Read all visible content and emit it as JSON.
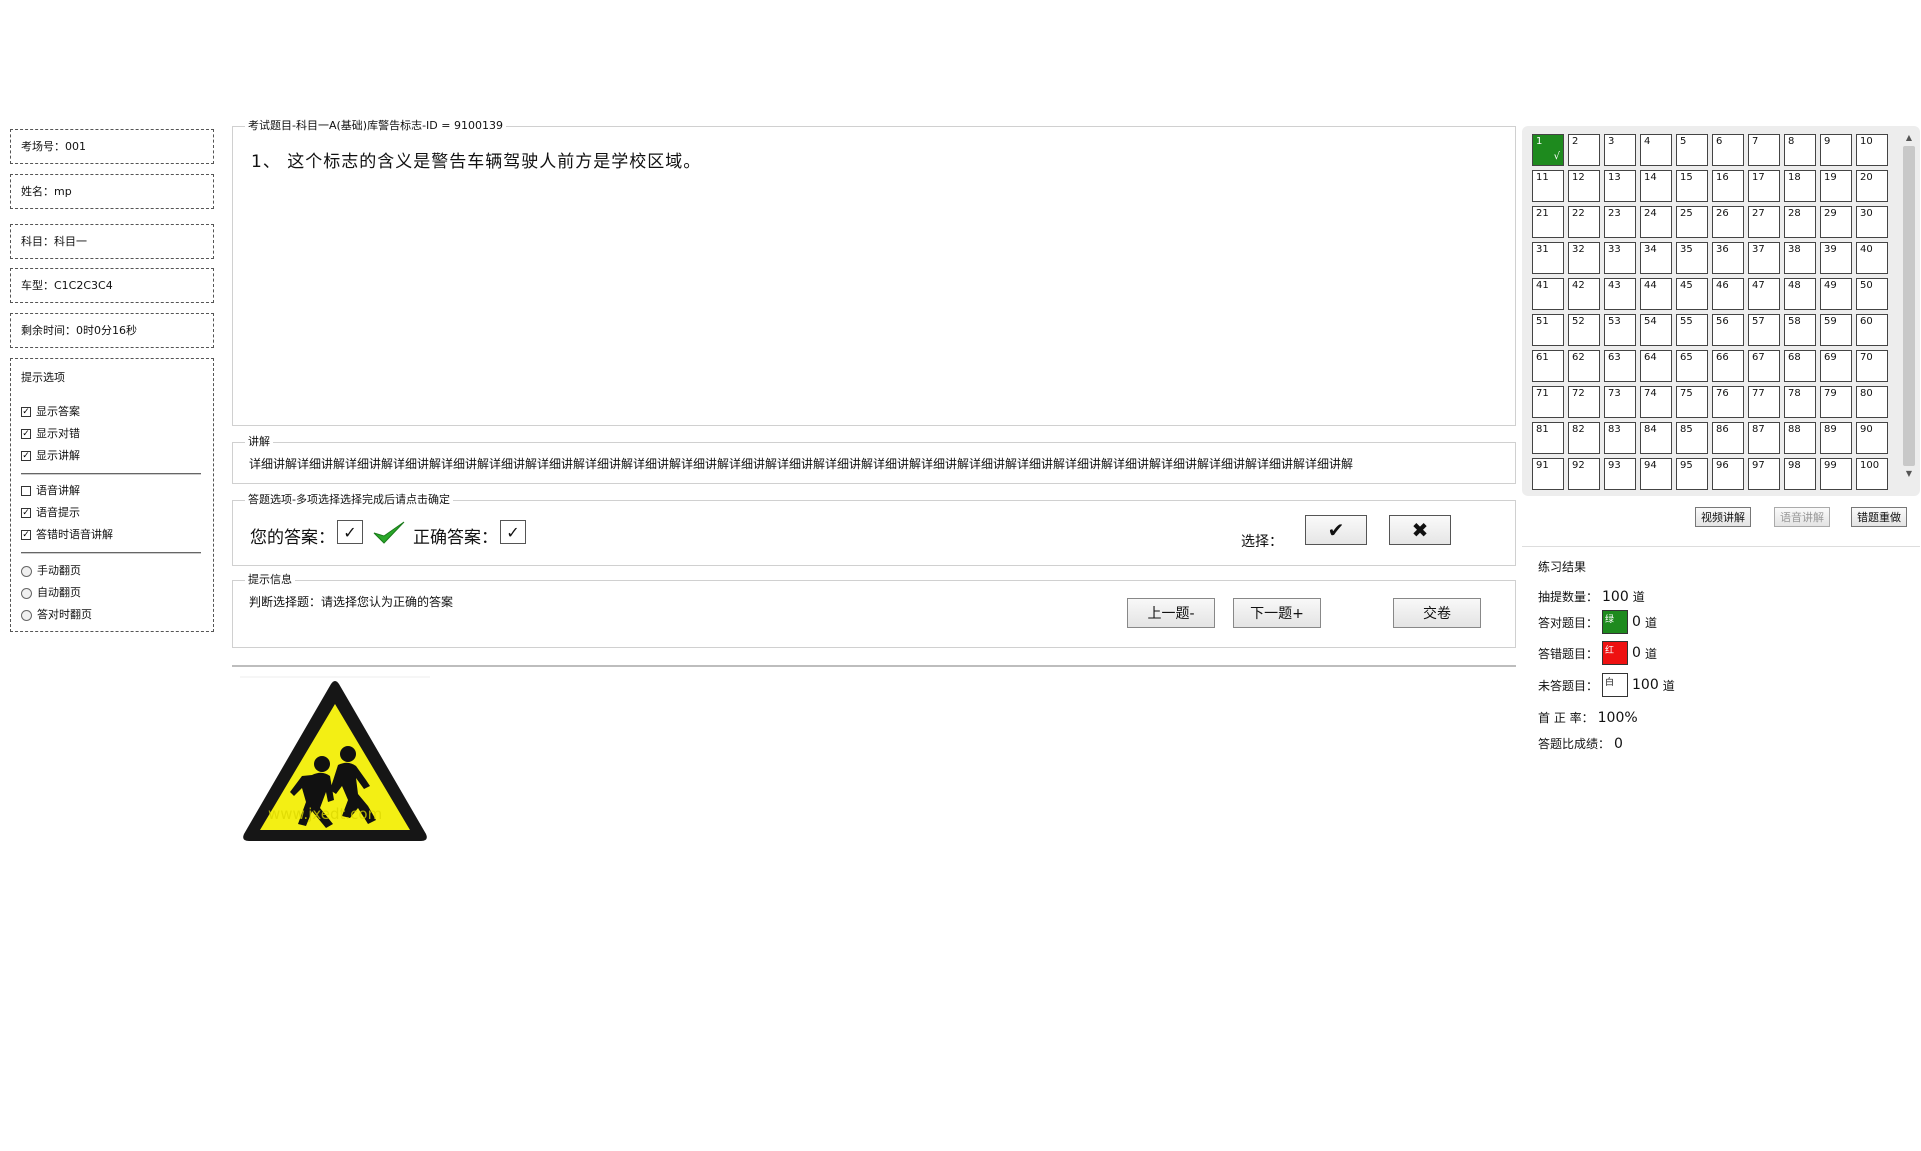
{
  "info": {
    "exam_room": "考场号：001",
    "name": "姓名：mp",
    "subject": "科目：科目一",
    "vehicle": "车型：C1C2C3C4",
    "time_left": "剩余时间：0时0分16秒"
  },
  "options": {
    "title": "提示选项",
    "items": [
      {
        "label": "显示答案",
        "checked": true
      },
      {
        "label": "显示对错",
        "checked": true
      },
      {
        "label": "显示讲解",
        "checked": true
      },
      {
        "label": "语音讲解",
        "checked": false
      },
      {
        "label": "语音提示",
        "checked": true
      },
      {
        "label": "答错时语音讲解",
        "checked": true
      }
    ],
    "radios": [
      "手动翻页",
      "自动翻页",
      "答对时翻页"
    ]
  },
  "question": {
    "group_title": "考试题目-科目一A(基础)库警告标志-ID = 9100139",
    "text": "1、 这个标志的含义是警告车辆驾驶人前方是学校区域。"
  },
  "explanation": {
    "group_title": "讲解",
    "text": "详细讲解详细讲解详细讲解详细讲解详细讲解详细讲解详细讲解详细讲解详细讲解详细讲解详细讲解详细讲解详细讲解详细讲解详细讲解详细讲解详细讲解详细讲解详细讲解详细讲解详细讲解详细讲解详细讲解"
  },
  "answer": {
    "group_title": "答题选项-多项选择选择完成后请点击确定",
    "your_label": "您的答案：",
    "your_value": "✓",
    "correct_label": "正确答案：",
    "correct_value": "✓",
    "choose_label": "选择：",
    "true_glyph": "✔",
    "false_glyph": "✖"
  },
  "hint": {
    "group_title": "提示信息",
    "text": "判断选择题：请选择您认为正确的答案",
    "prev": "上一题-",
    "next": "下一题+",
    "submit": "交卷"
  },
  "sign": {
    "watermark": "www.jxedt.com"
  },
  "grid": {
    "total": 100,
    "answered_correct": [
      1
    ],
    "correct_mark": "√"
  },
  "tools": {
    "video": "视频讲解",
    "voice": "语音讲解",
    "redo": "错题重做"
  },
  "results": {
    "title": "练习结果",
    "drawn_label": "抽提数量：",
    "drawn_value": "100",
    "unit": "道",
    "correct_label": "答对题目：",
    "correct_swatch": "绿",
    "correct_value": "0",
    "wrong_label": "答错题目：",
    "wrong_swatch": "红",
    "wrong_value": "0",
    "unanswered_label": "未答题目：",
    "unanswered_swatch": "白",
    "unanswered_value": "100",
    "accuracy_label": "首 正 率：",
    "accuracy_value": "100%",
    "score_label": "答题比成绩：",
    "score_value": "0"
  },
  "colors": {
    "correct": "#1e8a1e",
    "wrong": "#ee1111",
    "sign_yellow": "#f3ef14"
  }
}
